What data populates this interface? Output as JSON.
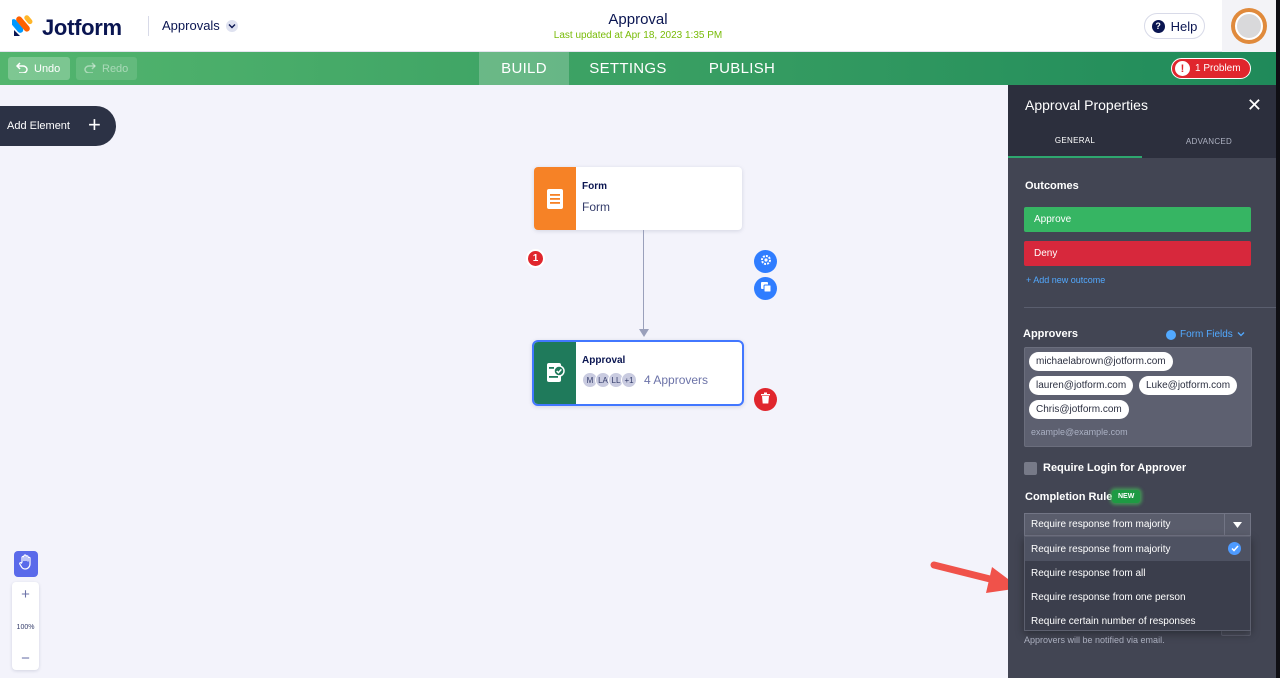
{
  "header": {
    "brand": "Jotform",
    "app_menu": "Approvals",
    "doc_title": "Approval",
    "doc_subtitle": "Last updated at Apr 18, 2023 1:35 PM",
    "help_label": "Help"
  },
  "toolbar": {
    "undo_label": "Undo",
    "redo_label": "Redo",
    "tabs": [
      {
        "label": "BUILD",
        "active": true
      },
      {
        "label": "SETTINGS",
        "active": false
      },
      {
        "label": "PUBLISH",
        "active": false
      }
    ],
    "problem_label": "1 Problem"
  },
  "canvas": {
    "add_element_label": "Add Element",
    "nodes": {
      "form": {
        "title": "Form",
        "subtitle": "Form",
        "color": "#f68226",
        "icon": "document-icon"
      },
      "approval": {
        "title": "Approval",
        "badge": "1",
        "color": "#1f7a5b",
        "icon": "approval-icon",
        "avatars": [
          "M",
          "LA",
          "LL",
          "+1"
        ],
        "approver_count_label": "4 Approvers"
      }
    },
    "zoom": {
      "level": "100%",
      "plus": "+",
      "minus": "−"
    }
  },
  "panel": {
    "title": "Approval Properties",
    "tabs": [
      {
        "label": "GENERAL",
        "active": true
      },
      {
        "label": "ADVANCED",
        "active": false
      }
    ],
    "outcomes_title": "Outcomes",
    "outcomes": [
      {
        "label": "Approve",
        "color": "#36b563"
      },
      {
        "label": "Deny",
        "color": "#d7283c"
      }
    ],
    "add_outcome_label": "+ Add new outcome",
    "approvers_title": "Approvers",
    "form_fields_label": "Form Fields",
    "approvers": [
      "michaelabrown@jotform.com",
      "lauren@jotform.com",
      "Luke@jotform.com",
      "Chris@jotform.com"
    ],
    "approver_placeholder": "example@example.com",
    "require_login_label": "Require Login for Approver",
    "require_login_checked": false,
    "completion_rule_title": "Completion Rule",
    "new_badge": "NEW",
    "completion_rule_selected": "Require response from majority",
    "completion_rule_options": [
      "Require response from majority",
      "Require response from all",
      "Require response from one person",
      "Require certain number of responses"
    ],
    "notify_text": "Approvers will be notified via email."
  }
}
